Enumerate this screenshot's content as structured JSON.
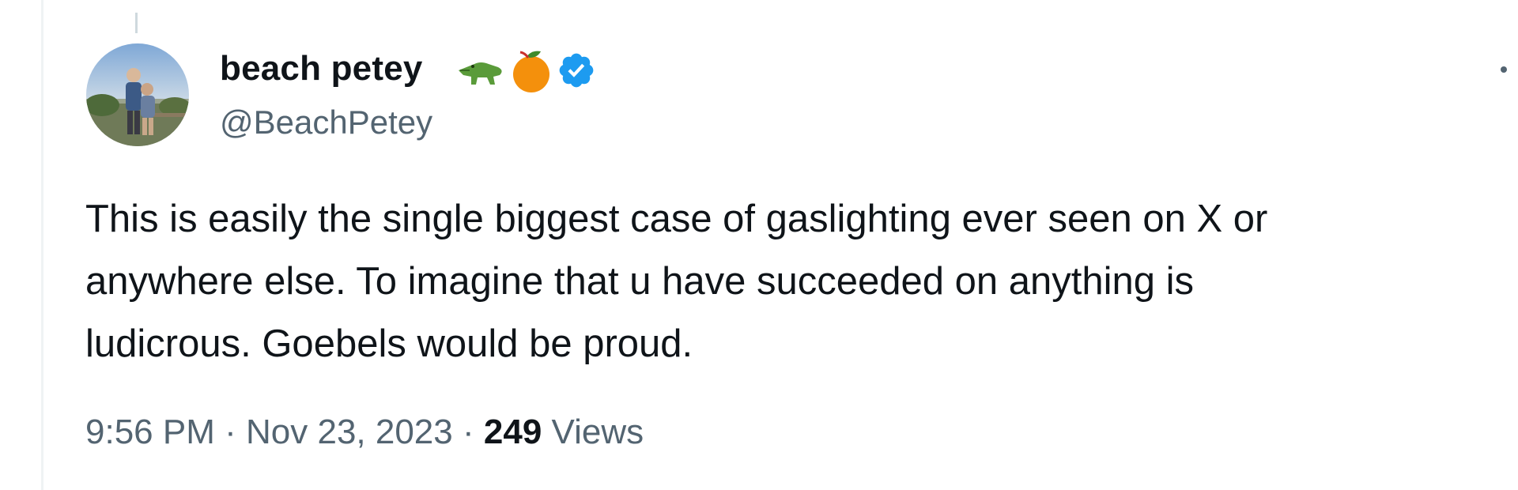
{
  "author": {
    "display_name": "beach petey",
    "handle": "@BeachPetey",
    "badges": [
      "crocodile-icon",
      "peach-icon",
      "verified-badge-icon"
    ]
  },
  "tweet": {
    "text_lines": [
      "This is easily the single biggest case of gaslighting ever seen on X or",
      "anywhere else. To imagine that u have succeeded on anything is",
      "ludicrous. Goebels would be proud."
    ],
    "time": "9:56 PM",
    "date": "Nov 23, 2023",
    "separator": "·",
    "views_count": "249",
    "views_label": "Views"
  },
  "colors": {
    "primary_text": "#0f1419",
    "secondary_text": "#536471",
    "verified_blue": "#1d9bf0",
    "crocodile_green": "#5a9b3a",
    "peach_orange": "#f4900c"
  }
}
